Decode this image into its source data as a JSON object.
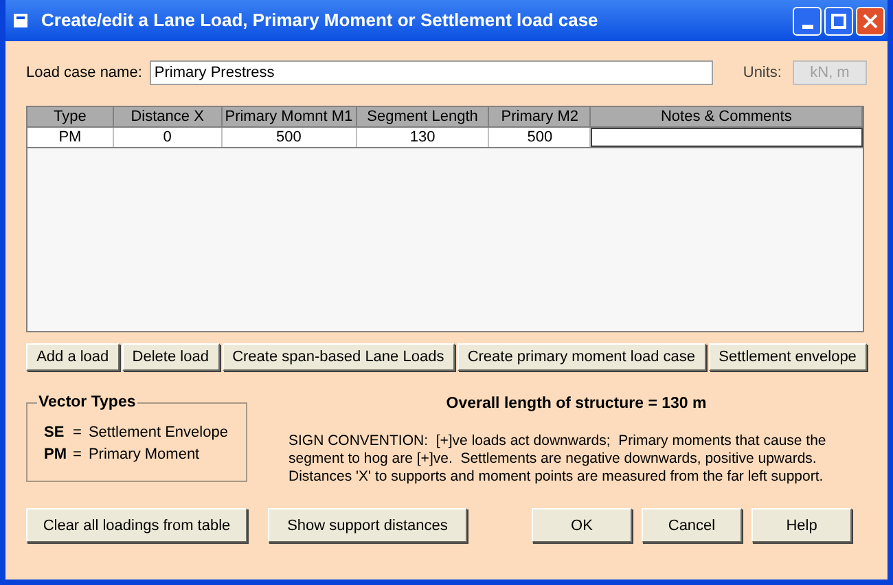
{
  "window": {
    "title": "Create/edit a Lane Load, Primary Moment or Settlement load case"
  },
  "load_case_name": {
    "label": "Load case name:",
    "value": "Primary Prestress"
  },
  "units": {
    "label": "Units:",
    "value": "kN, m"
  },
  "table": {
    "columns": [
      "Type",
      "Distance X",
      "Primary Momnt M1",
      "Segment Length",
      "Primary M2",
      "Notes & Comments"
    ],
    "rows": [
      [
        "PM",
        "0",
        "500",
        "130",
        "500",
        ""
      ]
    ]
  },
  "action_buttons": [
    "Add a load",
    "Delete load",
    "Create span-based Lane Loads",
    "Create primary moment load case",
    "Settlement envelope"
  ],
  "vector_types": {
    "title": "Vector Types",
    "items": [
      {
        "code": "SE",
        "sep": "=",
        "meaning": "Settlement Envelope"
      },
      {
        "code": "PM",
        "sep": "=",
        "meaning": "Primary Moment"
      }
    ]
  },
  "overall_length": "Overall length of structure = 130 m",
  "sign_convention_lines": [
    "SIGN CONVENTION:  [+]ve loads act downwards;  Primary moments that cause the",
    "segment to hog are [+]ve.  Settlements are negative downwards, positive upwards.",
    "Distances 'X' to supports and moment points are measured from the far left support."
  ],
  "bottom_buttons": [
    "Clear all loadings from table",
    "Show support distances",
    "OK",
    "Cancel",
    "Help"
  ]
}
